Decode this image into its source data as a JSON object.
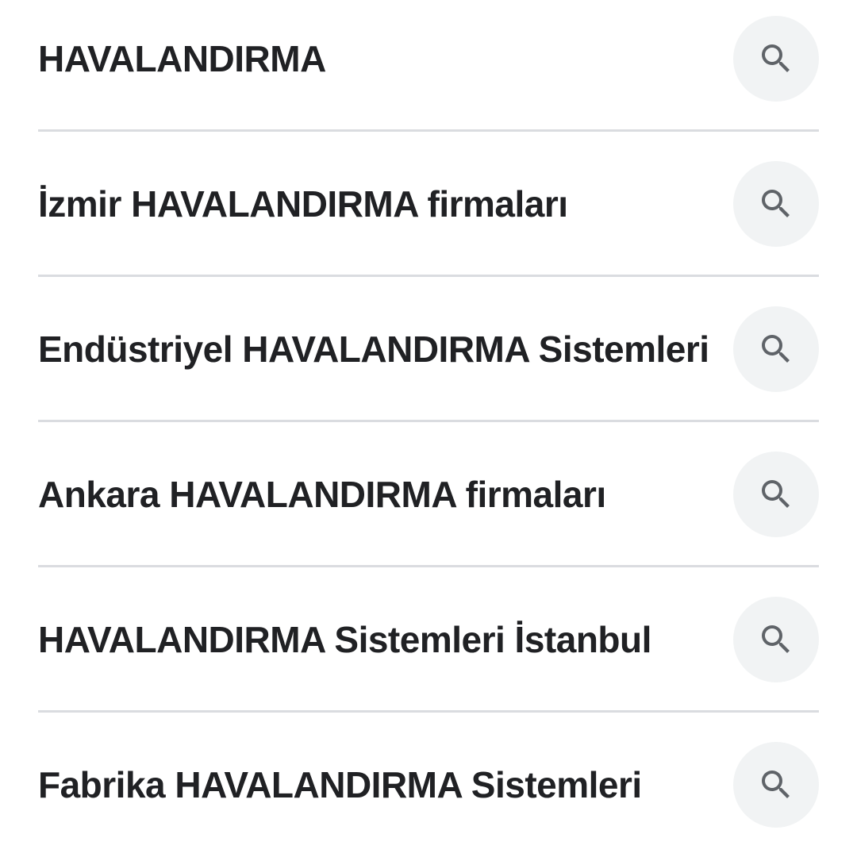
{
  "suggestions": [
    {
      "label": "HAVALANDIRMA",
      "icon": "search-icon"
    },
    {
      "label": "İzmir HAVALANDIRMA firmaları",
      "icon": "search-icon"
    },
    {
      "label": "Endüstriyel HAVALANDIRMA Sistemleri",
      "icon": "search-icon"
    },
    {
      "label": "Ankara HAVALANDIRMA firmaları",
      "icon": "search-icon"
    },
    {
      "label": "HAVALANDIRMA Sistemleri İstanbul",
      "icon": "search-icon"
    },
    {
      "label": "Fabrika HAVALANDIRMA Sistemleri",
      "icon": "search-icon"
    }
  ],
  "colors": {
    "text": "#202124",
    "icon": "#5f6368",
    "icon_bg": "#f1f3f4",
    "divider": "#dadce0"
  }
}
